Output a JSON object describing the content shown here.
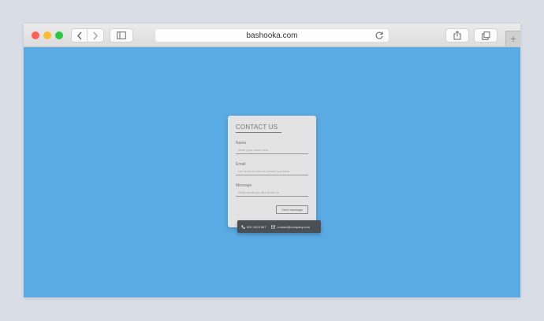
{
  "browser": {
    "url": "bashooka.com",
    "icons": {
      "back": "chevron-left-icon",
      "forward": "chevron-right-icon",
      "sidebar": "sidebar-icon",
      "reload": "reload-icon",
      "share": "share-icon",
      "tabs": "tabs-icon"
    },
    "new_tab_label": "+"
  },
  "colors": {
    "page_background": "#5aaae3",
    "card": "#e3e3e3",
    "contact_bar": "#4a4e55"
  },
  "contact_form": {
    "title": "CONTACT US",
    "fields": [
      {
        "label": "Name",
        "placeholder": "Write your name here"
      },
      {
        "label": "Email",
        "placeholder": "Let us know how to contact you back"
      },
      {
        "label": "Message",
        "placeholder": "What would you like to tell us"
      }
    ],
    "send_label": "Send message"
  },
  "contact_info": {
    "phone": "001 1023 567",
    "email": "contact@company.com"
  }
}
